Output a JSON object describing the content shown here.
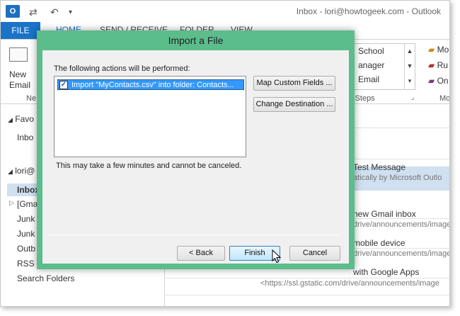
{
  "app": {
    "window_title": "Inbox - lori@howtogeek.com - Outlook",
    "logo_text": "O"
  },
  "ribbon": {
    "file_tab": "FILE",
    "tabs": [
      "HOME",
      "SEND / RECEIVE",
      "FOLDER",
      "VIEW"
    ],
    "new_email_line1": "New",
    "new_email_line2": "Email",
    "new_group_label": "Ne",
    "quick_steps": [
      "School",
      "anager",
      "Email"
    ],
    "quick_steps_group": "k Steps",
    "right_items": [
      "Mo",
      "Ru",
      "On"
    ],
    "right_group": "Mo"
  },
  "nav": {
    "favorites": "Favo",
    "favorites_inbox": "Inbo",
    "account": "lori@",
    "items": [
      "Inbox",
      "[Gma",
      "Junk",
      "Junk",
      "Outb",
      "RSS F",
      "Search Folders"
    ]
  },
  "mail": [
    {
      "subject": "Test Message",
      "preview": "atically by Microsoft Outlo"
    },
    {
      "subject": "new Gmail inbox",
      "preview": "drive/announcements/image"
    },
    {
      "subject": "mobile device",
      "preview": "drive/announcements/image"
    },
    {
      "subject": "with Google Apps",
      "preview": "<https://ssl.gstatic.com/drive/announcements/image"
    }
  ],
  "dialog": {
    "title": "Import a File",
    "actions_label": "The following actions will be performed:",
    "action_item": "Import \"MyContacts.csv\" into folder: Contacts...",
    "action_checked": true,
    "note": "This may take a few minutes and cannot be canceled.",
    "map_button": "Map Custom Fields ...",
    "change_button": "Change Destination ...",
    "back_button": "< Back",
    "finish_button": "Finish",
    "cancel_button": "Cancel"
  }
}
